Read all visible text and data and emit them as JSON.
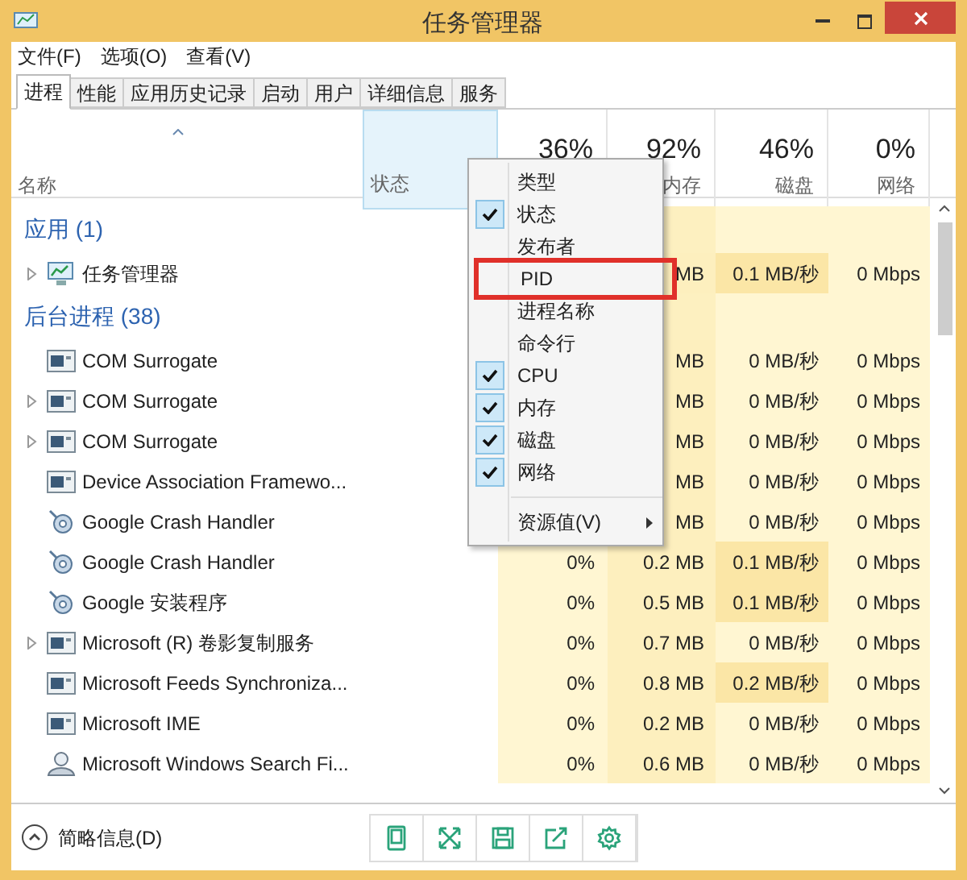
{
  "window": {
    "title": "任务管理器"
  },
  "menu_bar": [
    "文件(F)",
    "选项(O)",
    "查看(V)"
  ],
  "tabs": [
    {
      "label": "进程",
      "selected": true
    },
    {
      "label": "性能",
      "selected": false
    },
    {
      "label": "应用历史记录",
      "selected": false
    },
    {
      "label": "启动",
      "selected": false
    },
    {
      "label": "用户",
      "selected": false
    },
    {
      "label": "详细信息",
      "selected": false
    },
    {
      "label": "服务",
      "selected": false
    }
  ],
  "columns": [
    {
      "label": "名称",
      "hovered": false
    },
    {
      "label": "状态",
      "hovered": true
    },
    {
      "usage": "36%",
      "hovered": false
    },
    {
      "label": "内存",
      "usage": "92%",
      "hovered": false
    },
    {
      "label": "磁盘",
      "usage": "46%",
      "hovered": false
    },
    {
      "label": "网络",
      "usage": "0%",
      "hovered": false
    }
  ],
  "rows": [
    {
      "kind": "group",
      "name": "应用 (1)"
    },
    {
      "kind": "app",
      "expandable": true,
      "name": "任务管理器",
      "memory": "MB",
      "disk": "0.1 MB/秒",
      "disk_busy": true,
      "network": "0 Mbps"
    },
    {
      "kind": "group",
      "name": "后台进程 (38)"
    },
    {
      "kind": "window",
      "expandable": false,
      "name": "COM Surrogate",
      "memory": "MB",
      "disk": "0 MB/秒",
      "disk_busy": false,
      "network": "0 Mbps"
    },
    {
      "kind": "window",
      "expandable": true,
      "name": "COM Surrogate",
      "memory": "MB",
      "disk": "0 MB/秒",
      "disk_busy": false,
      "network": "0 Mbps"
    },
    {
      "kind": "window",
      "expandable": true,
      "name": "COM Surrogate",
      "memory": "MB",
      "disk": "0 MB/秒",
      "disk_busy": false,
      "network": "0 Mbps"
    },
    {
      "kind": "window",
      "expandable": false,
      "name": "Device Association Framewo...",
      "memory": "MB",
      "disk": "0 MB/秒",
      "disk_busy": false,
      "network": "0 Mbps"
    },
    {
      "kind": "crash",
      "expandable": false,
      "name": "Google Crash Handler",
      "memory": "MB",
      "disk": "0 MB/秒",
      "disk_busy": false,
      "network": "0 Mbps"
    },
    {
      "kind": "crash",
      "expandable": false,
      "name": "Google Crash Handler",
      "cpu": "0%",
      "memory": "0.2 MB",
      "disk": "0.1 MB/秒",
      "disk_busy": true,
      "network": "0 Mbps"
    },
    {
      "kind": "crash",
      "expandable": false,
      "name": "Google 安装程序",
      "cpu": "0%",
      "memory": "0.5 MB",
      "disk": "0.1 MB/秒",
      "disk_busy": true,
      "network": "0 Mbps"
    },
    {
      "kind": "window",
      "expandable": true,
      "name": "Microsoft (R) 卷影复制服务",
      "cpu": "0%",
      "memory": "0.7 MB",
      "disk": "0 MB/秒",
      "disk_busy": false,
      "network": "0 Mbps"
    },
    {
      "kind": "window",
      "expandable": false,
      "name": "Microsoft Feeds Synchroniza...",
      "cpu": "0%",
      "memory": "0.8 MB",
      "disk": "0.2 MB/秒",
      "disk_busy": true,
      "network": "0 Mbps"
    },
    {
      "kind": "window",
      "expandable": false,
      "name": "Microsoft IME",
      "cpu": "0%",
      "memory": "0.2 MB",
      "disk": "0 MB/秒",
      "disk_busy": false,
      "network": "0 Mbps"
    },
    {
      "kind": "search",
      "expandable": false,
      "name": "Microsoft Windows Search Fi...",
      "cpu": "0%",
      "memory": "0.6 MB",
      "disk": "0 MB/秒",
      "disk_busy": false,
      "network": "0 Mbps"
    }
  ],
  "context_menu": [
    {
      "label": "类型",
      "checked": false,
      "boxed": false,
      "submenu": false
    },
    {
      "label": "状态",
      "checked": true,
      "boxed": false,
      "submenu": false
    },
    {
      "label": "发布者",
      "checked": false,
      "boxed": false,
      "submenu": false
    },
    {
      "label": "PID",
      "checked": false,
      "boxed": true,
      "submenu": false
    },
    {
      "label": "进程名称",
      "checked": false,
      "boxed": false,
      "submenu": false
    },
    {
      "label": "命令行",
      "checked": false,
      "boxed": false,
      "submenu": false
    },
    {
      "label": "CPU",
      "checked": true,
      "boxed": false,
      "submenu": false
    },
    {
      "label": "内存",
      "checked": true,
      "boxed": false,
      "submenu": false
    },
    {
      "label": "磁盘",
      "checked": true,
      "boxed": false,
      "submenu": false
    },
    {
      "label": "网络",
      "checked": true,
      "boxed": false,
      "submenu": false
    },
    {
      "label": "资源值(V)",
      "checked": false,
      "boxed": false,
      "submenu": true
    }
  ],
  "footer": {
    "label": "简略信息(D)"
  }
}
